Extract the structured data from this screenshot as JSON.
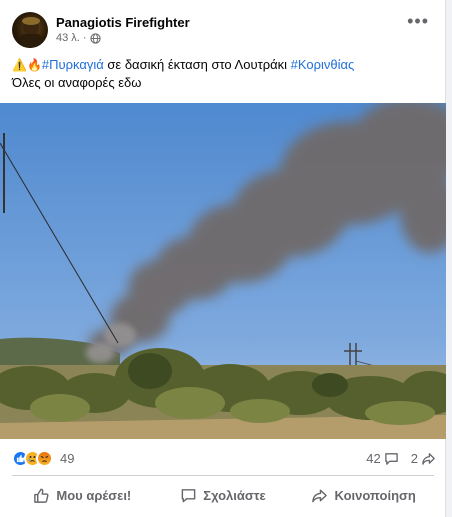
{
  "post": {
    "author": "Panagiotis Firefighter",
    "time": "43 λ.",
    "separator": "·",
    "text_emojis": "⚠️🔥",
    "hashtag_1": "#Πυρκαγιά",
    "text_mid": " σε δασική έκταση στο Λουτράκι ",
    "hashtag_2": "#Κορινθίας",
    "text_line2": "Όλες οι αναφορές εδω"
  },
  "stats": {
    "reaction_count": "49",
    "comment_count": "42",
    "share_count": "2"
  },
  "actions": {
    "like": "Μου αρέσει!",
    "comment": "Σχολιάστε",
    "share": "Κοινοποίηση"
  },
  "colors": {
    "hashtag": "#216fdb",
    "like_blue": "#1877f2",
    "sky": "#5f97d6",
    "smoke": "#6e6a6a"
  },
  "icons": {
    "privacy": "globe-icon",
    "more": "more-dots-icon",
    "like_action": "thumbs-up-icon",
    "comment_action": "comment-icon",
    "share_action": "share-arrow-icon"
  }
}
